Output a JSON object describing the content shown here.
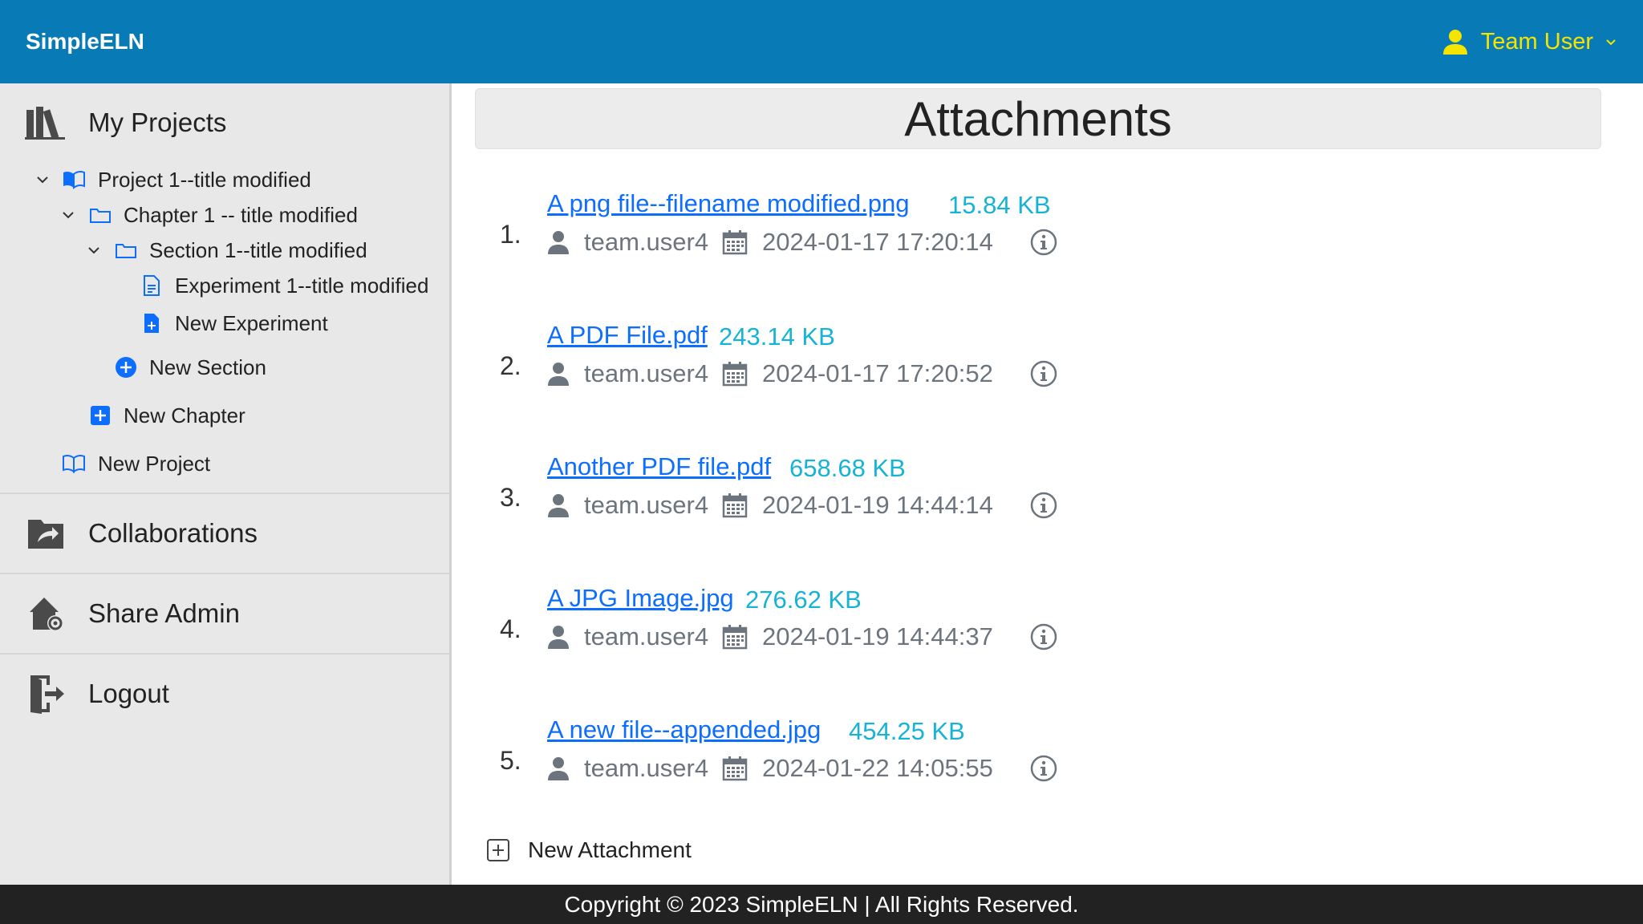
{
  "app": {
    "brand": "SimpleELN"
  },
  "header": {
    "user_name": "Team User",
    "user_icon": "person-icon",
    "accent": "#f5e400",
    "background": "#087bb6"
  },
  "sidebar": {
    "my_projects": "My Projects",
    "tree": {
      "project": "Project 1--title modified",
      "chapter": "Chapter 1 -- title modified",
      "section": "Section 1--title modified",
      "experiment": "Experiment 1--title modified",
      "new_experiment": "New Experiment",
      "new_section": "New Section",
      "new_chapter": "New Chapter",
      "new_project": "New Project"
    },
    "collaborations": "Collaborations",
    "share_admin": "Share Admin",
    "logout": "Logout"
  },
  "main": {
    "title": "Attachments",
    "attachments": [
      {
        "num": "1.",
        "name": "A png file--filename modified.png",
        "size": "15.84 KB",
        "user": "team.user4",
        "date": "2024-01-17 17:20:14"
      },
      {
        "num": "2.",
        "name": "A PDF File.pdf",
        "size": "243.14 KB",
        "user": "team.user4",
        "date": "2024-01-17 17:20:52"
      },
      {
        "num": "3.",
        "name": "Another PDF file.pdf",
        "size": "658.68 KB",
        "user": "team.user4",
        "date": "2024-01-19 14:44:14"
      },
      {
        "num": "4.",
        "name": "A JPG Image.jpg",
        "size": "276.62 KB",
        "user": "team.user4",
        "date": "2024-01-19 14:44:37"
      },
      {
        "num": "5.",
        "name": "A new file--appended.jpg",
        "size": "454.25 KB",
        "user": "team.user4",
        "date": "2024-01-22 14:05:55"
      }
    ],
    "new_attachment": "New Attachment"
  },
  "footer": {
    "text": "Copyright © 2023 SimpleELN | All Rights Reserved."
  },
  "colors": {
    "link": "#0d6efd",
    "size": "#17b3d6",
    "meta": "#6c757d",
    "footer": "#222222"
  }
}
